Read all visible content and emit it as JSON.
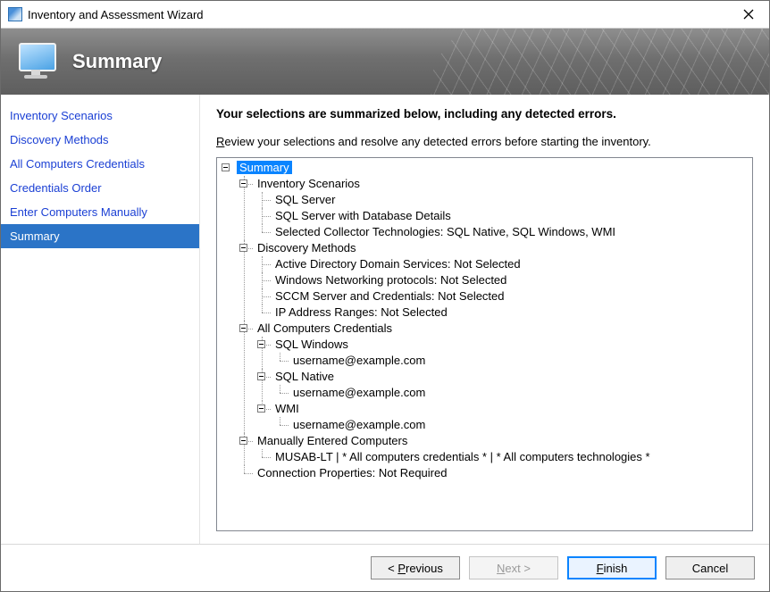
{
  "window": {
    "title": "Inventory and Assessment Wizard"
  },
  "banner": {
    "title": "Summary"
  },
  "sidebar": {
    "items": [
      {
        "label": "Inventory Scenarios",
        "current": false
      },
      {
        "label": "Discovery Methods",
        "current": false
      },
      {
        "label": "All Computers Credentials",
        "current": false
      },
      {
        "label": "Credentials Order",
        "current": false
      },
      {
        "label": "Enter Computers Manually",
        "current": false
      },
      {
        "label": "Summary",
        "current": true
      }
    ]
  },
  "main": {
    "headline": "Your selections are summarized below, including any detected errors.",
    "instruction_accel": "R",
    "instruction_rest": "eview your selections and resolve any detected errors before starting the inventory."
  },
  "tree": {
    "root": "Summary",
    "inventory_scenarios": {
      "label": "Inventory Scenarios",
      "items": [
        "SQL Server",
        "SQL Server with Database Details",
        "Selected Collector Technologies: SQL Native, SQL Windows, WMI"
      ]
    },
    "discovery_methods": {
      "label": "Discovery Methods",
      "items": [
        "Active Directory Domain Services: Not Selected",
        "Windows Networking protocols: Not Selected",
        "SCCM Server and Credentials: Not Selected",
        "IP Address Ranges: Not Selected"
      ]
    },
    "credentials": {
      "label": "All Computers Credentials",
      "groups": [
        {
          "name": "SQL Windows",
          "items": [
            "username@example.com"
          ]
        },
        {
          "name": "SQL Native",
          "items": [
            "username@example.com"
          ]
        },
        {
          "name": "WMI",
          "items": [
            "username@example.com"
          ]
        }
      ]
    },
    "manual": {
      "label": "Manually Entered Computers",
      "items": [
        "MUSAB-LT | * All computers credentials * | * All computers technologies *"
      ]
    },
    "connection_properties": "Connection Properties: Not Required"
  },
  "buttons": {
    "previous_sym": "<",
    "previous_label": " Previous",
    "next_label": "Next ",
    "next_sym": ">",
    "finish_label": "Finish",
    "cancel_label": "Cancel"
  }
}
